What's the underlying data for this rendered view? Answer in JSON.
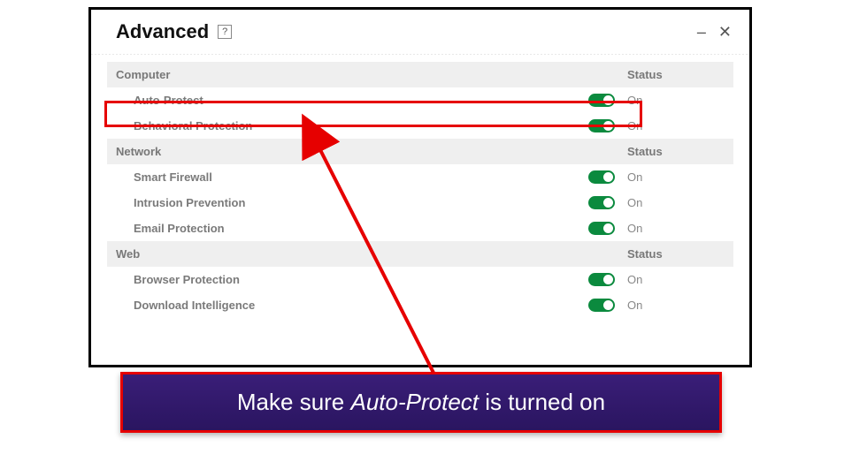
{
  "header": {
    "title": "Advanced",
    "help_symbol": "?",
    "minimize": "–",
    "close": "✕"
  },
  "columns": {
    "status_header": "Status",
    "on_label": "On"
  },
  "sections": [
    {
      "name": "Computer",
      "items": [
        {
          "name": "Auto-Protect",
          "on": true
        },
        {
          "name": "Behavioral Protection",
          "on": true
        }
      ]
    },
    {
      "name": "Network",
      "items": [
        {
          "name": "Smart Firewall",
          "on": true
        },
        {
          "name": "Intrusion Prevention",
          "on": true
        },
        {
          "name": "Email Protection",
          "on": true
        }
      ]
    },
    {
      "name": "Web",
      "items": [
        {
          "name": "Browser Protection",
          "on": true
        },
        {
          "name": "Download Intelligence",
          "on": true
        }
      ]
    }
  ],
  "callout": {
    "prefix": "Make sure ",
    "em": "Auto-Protect",
    "suffix": " is turned on"
  }
}
